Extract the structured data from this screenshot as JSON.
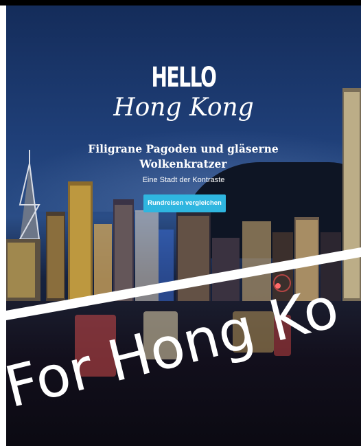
{
  "hero": {
    "title_line_1": "HELLO",
    "title_line_2": "Hong Kong",
    "subtitle": "Filigrane Pagoden und gläserne Wolkenkratzer",
    "tagline": "Eine Stadt der Kontraste",
    "cta_label": "Rundreisen vergleichen"
  },
  "overlay": {
    "text": "For Hong Ko"
  },
  "colors": {
    "cta": "#2fb6e0",
    "sky": "#1f3f78",
    "water": "#120f1c"
  }
}
